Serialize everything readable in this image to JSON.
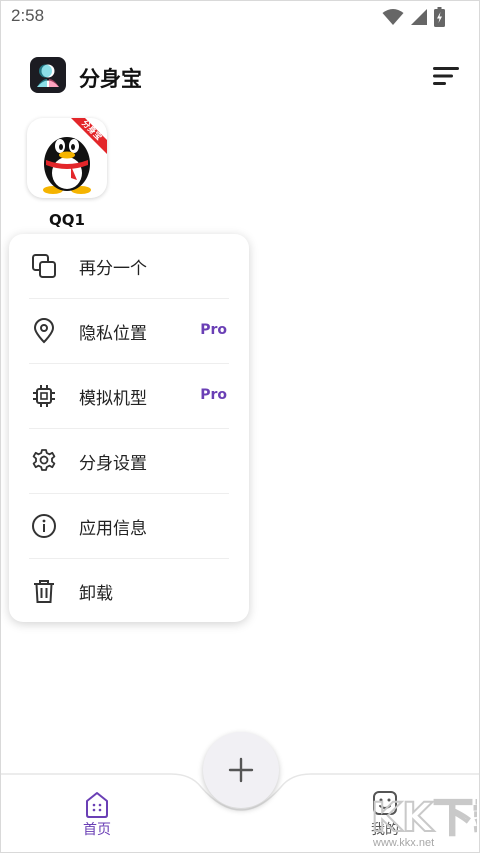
{
  "status_bar": {
    "time": "2:58"
  },
  "header": {
    "title": "分身宝"
  },
  "apps": [
    {
      "label": "QQ1",
      "badge": "分身宝"
    }
  ],
  "context_menu": {
    "items": [
      {
        "label": "再分一个",
        "icon": "copy-icon",
        "pro": ""
      },
      {
        "label": "隐私位置",
        "icon": "location-pin-icon",
        "pro": "Pro"
      },
      {
        "label": "模拟机型",
        "icon": "chip-icon",
        "pro": "Pro"
      },
      {
        "label": "分身设置",
        "icon": "gear-icon",
        "pro": ""
      },
      {
        "label": "应用信息",
        "icon": "info-icon",
        "pro": ""
      },
      {
        "label": "卸载",
        "icon": "trash-icon",
        "pro": ""
      }
    ]
  },
  "bottom_nav": {
    "home_label": "首页",
    "mine_label": "我的",
    "add_icon": "plus-icon"
  },
  "watermark": {
    "text": "KK下载",
    "url": "www.kkx.net"
  },
  "colors": {
    "accent": "#6a3fb5",
    "background": "#ffffff"
  }
}
